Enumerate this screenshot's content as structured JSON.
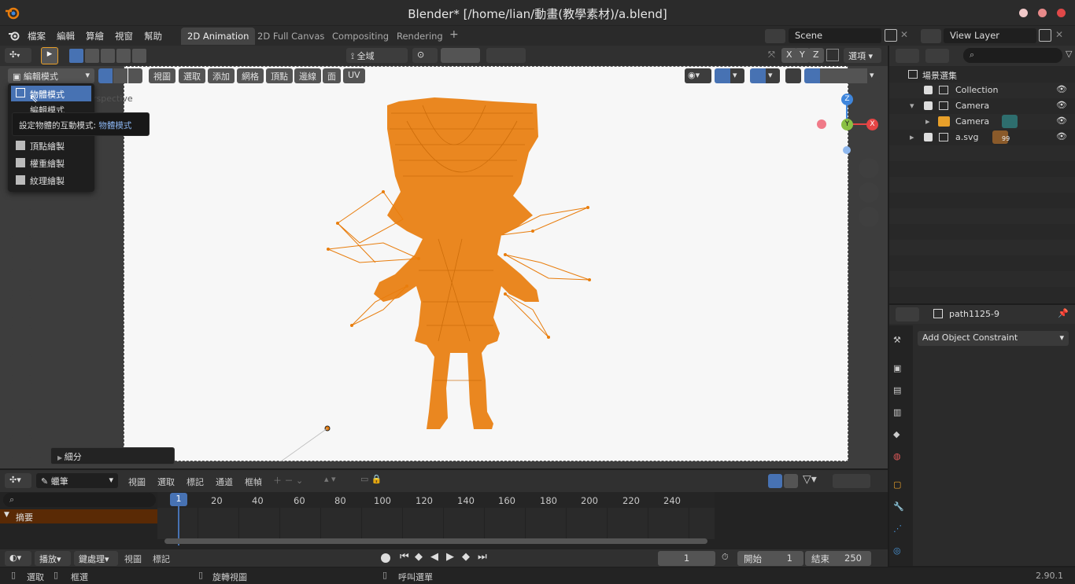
{
  "window": {
    "title": "Blender* [/home/lian/動畫(教學素材)/a.blend]",
    "dot_colors": [
      "#f0c8c8",
      "#e88a8a",
      "#e04848"
    ]
  },
  "menu": [
    "檔案",
    "編輯",
    "算繪",
    "視窗",
    "幫助"
  ],
  "workspaces": [
    "2D Animation",
    "2D Full Canvas",
    "Compositing",
    "Rendering"
  ],
  "add_workspace": "+",
  "scene": {
    "label": "Scene"
  },
  "view_layer": {
    "label": "View Layer"
  },
  "viewport_header": {
    "orientation": "全域",
    "axes": [
      "X",
      "Y",
      "Z"
    ],
    "options": "選項",
    "mode": "編輯模式",
    "menus": [
      "視圖",
      "選取",
      "添加",
      "網格",
      "頂點",
      "邊線",
      "面",
      "UV"
    ]
  },
  "viewport": {
    "overlay_text": "rspective",
    "gizmo": {
      "z": "Z",
      "y": "Y",
      "x": "X"
    },
    "panel_label": "細分"
  },
  "mode_menu": {
    "items": [
      "物體模式",
      "編輯模式",
      "頂點繪製",
      "權重繪製",
      "紋理繪製"
    ],
    "selected_index": 0
  },
  "tooltip": {
    "text": "設定物體的互動模式:",
    "value": "物體模式"
  },
  "outliner": {
    "header": "場景選集",
    "rows": [
      {
        "label": "Collection",
        "indent": 1
      },
      {
        "label": "Camera",
        "indent": 1,
        "expand": "▾"
      },
      {
        "label": "Camera",
        "indent": 2,
        "expand": "▸"
      },
      {
        "label": "a.svg",
        "indent": 1,
        "expand": "▸"
      }
    ],
    "asvg_badge": "99"
  },
  "properties": {
    "object_name": "path1125-9",
    "constraint_dropdown": "Add Object Constraint"
  },
  "timeline_header": {
    "layer": "蠟筆",
    "menus": [
      "視圖",
      "選取",
      "標記",
      "通道",
      "框幀"
    ]
  },
  "timeline": {
    "summary": "摘要",
    "current_frame_label": "1",
    "ticks": [
      "20",
      "40",
      "60",
      "80",
      "100",
      "120",
      "140",
      "160",
      "180",
      "200",
      "220",
      "240"
    ]
  },
  "playbar": {
    "menus": [
      "播放",
      "鍵處理",
      "視圖",
      "標記"
    ],
    "current_frame": "1",
    "start_label": "開始",
    "start": "1",
    "end_label": "結束",
    "end": "250"
  },
  "statusbar": {
    "items": [
      "選取",
      "框選",
      "旋轉視圖",
      "呼叫選單"
    ],
    "version": "2.90.1"
  },
  "colors": {
    "accent": "#4772b3",
    "mesh": "#e87d0d",
    "gizmo_x": "#e54545",
    "gizmo_y": "#8ac043",
    "gizmo_z": "#3f86dc"
  }
}
